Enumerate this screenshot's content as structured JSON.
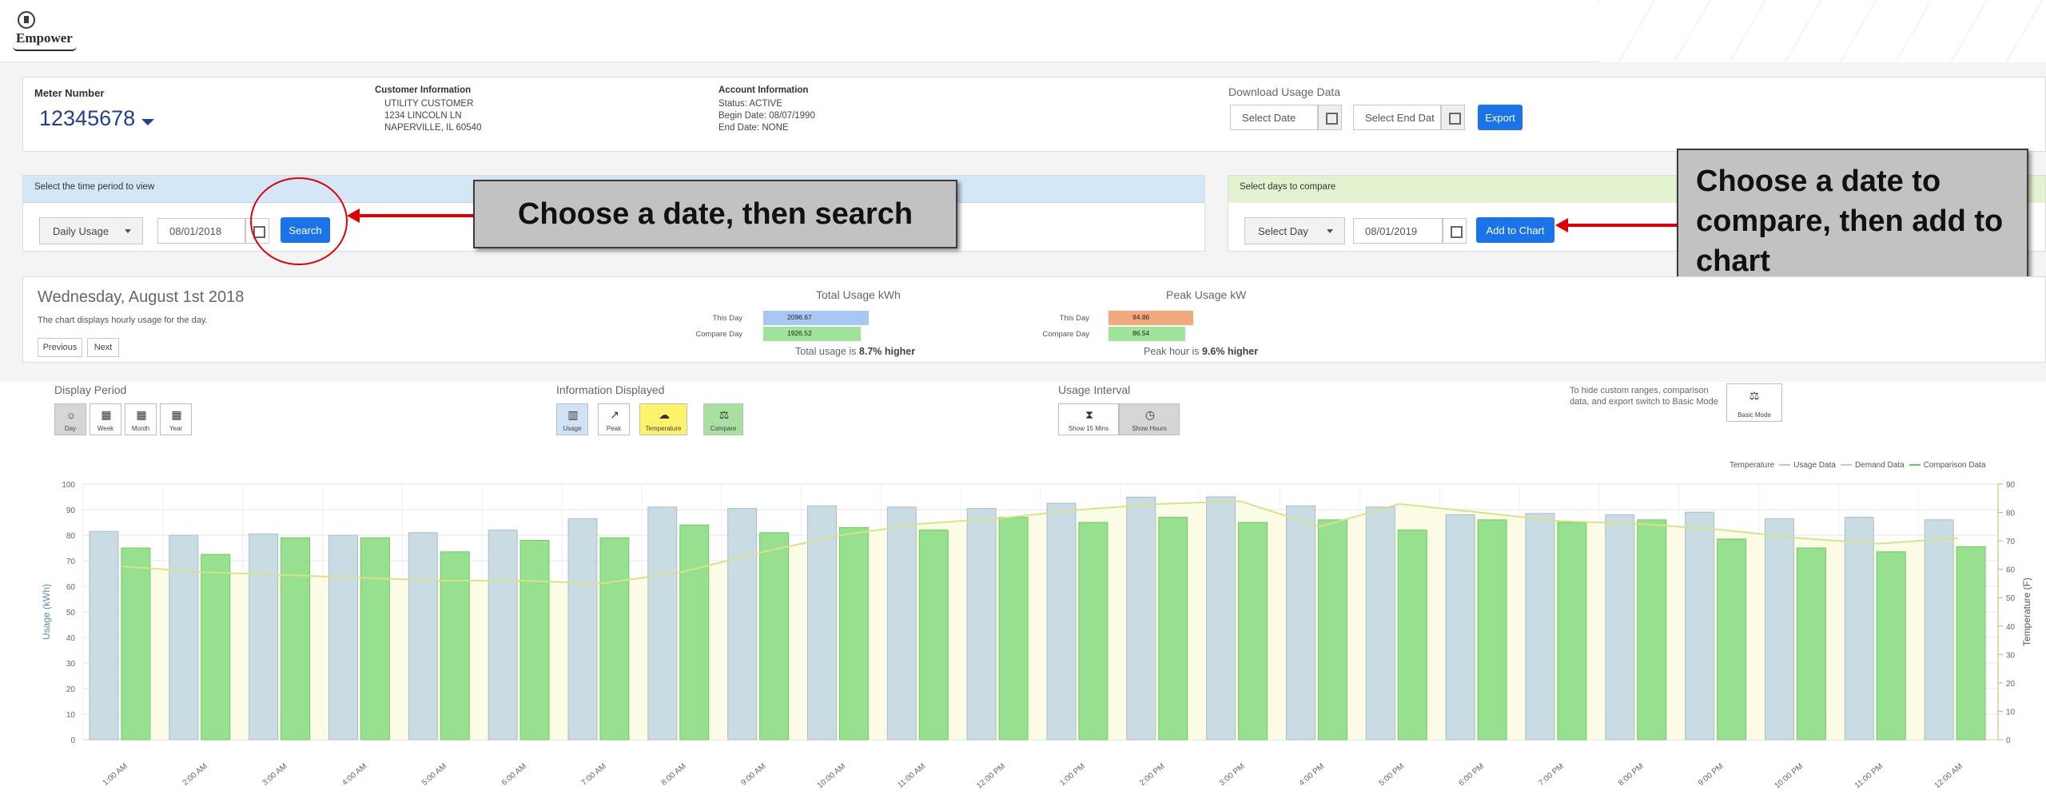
{
  "brand": {
    "logo_text": "Empower"
  },
  "meter": {
    "label": "Meter Number",
    "number": "12345678"
  },
  "customer": {
    "label": "Customer Information",
    "lines": [
      "UTILITY CUSTOMER",
      "1234 LINCOLN LN",
      "NAPERVILLE, IL 60540"
    ]
  },
  "account": {
    "label": "Account Information",
    "lines": [
      "Status: ACTIVE",
      "Begin Date: 08/07/1990",
      "End Date: NONE"
    ]
  },
  "download": {
    "label": "Download Usage Data",
    "start_placeholder": "Select Date",
    "end_placeholder": "Select End Dat",
    "export_label": "Export"
  },
  "period_panel": {
    "header": "Select the time period to view",
    "select_value": "Daily Usage",
    "date_value": "08/01/2018",
    "search_label": "Search"
  },
  "compare_panel": {
    "header": "Select days to compare",
    "select_value": "Select Day",
    "date_value": "08/01/2019",
    "add_label": "Add to Chart"
  },
  "callouts": {
    "search": "Choose a date, then search",
    "compare": "Choose a date to compare, then add to chart"
  },
  "summary": {
    "date_title": "Wednesday, August 1st 2018",
    "subtitle": "The chart displays hourly usage for the day.",
    "prev_label": "Previous",
    "next_label": "Next",
    "total_title": "Total Usage kWh",
    "this_day_label": "This Day",
    "compare_day_label": "Compare Day",
    "total_this_day": "2096.67",
    "total_compare_day": "1926.52",
    "total_note_prefix": "Total usage is ",
    "total_note_value": "8.7% higher",
    "peak_title": "Peak Usage kW",
    "peak_this_day": "94.86",
    "peak_compare_day": "86.54",
    "peak_note_prefix": "Peak hour is ",
    "peak_note_value": "9.6% higher"
  },
  "controls": {
    "display_period_title": "Display Period",
    "display_period": [
      "Day",
      "Week",
      "Month",
      "Year"
    ],
    "info_title": "Information Displayed",
    "info": [
      "Usage",
      "Peak",
      "Temperature",
      "Compare"
    ],
    "interval_title": "Usage Interval",
    "interval": [
      "Show 15 Mins",
      "Show Hours"
    ],
    "hint": "To hide custom ranges, comparison data, and export switch to Basic Mode",
    "basic_mode_label": "Basic Mode"
  },
  "colors": {
    "usage": "#c9dbe3",
    "compare": "#96e08f",
    "temperature": "#d8e28a",
    "accent": "#1a73e8",
    "annotation": "#e00000"
  },
  "chart_data": {
    "type": "bar",
    "categories": [
      "1:00 AM",
      "2:00 AM",
      "3:00 AM",
      "4:00 AM",
      "5:00 AM",
      "6:00 AM",
      "7:00 AM",
      "8:00 AM",
      "9:00 AM",
      "10:00 AM",
      "11:00 AM",
      "12:00 PM",
      "1:00 PM",
      "2:00 PM",
      "3:00 PM",
      "4:00 PM",
      "5:00 PM",
      "6:00 PM",
      "7:00 PM",
      "8:00 PM",
      "9:00 PM",
      "10:00 PM",
      "11:00 PM",
      "12:00 AM"
    ],
    "series": [
      {
        "name": "Usage Data",
        "values": [
          81.5,
          80,
          80.5,
          80,
          81,
          82,
          86.5,
          91,
          90.5,
          91.5,
          91,
          90.5,
          92.5,
          94.9,
          95,
          91.5,
          91,
          88,
          88.5,
          88,
          89,
          86.5,
          87,
          86
        ]
      },
      {
        "name": "Comparison Data",
        "values": [
          75,
          72.5,
          79,
          79,
          73.5,
          78,
          79,
          84,
          81,
          83,
          82,
          87,
          85,
          87,
          85,
          86,
          82,
          86,
          85,
          86,
          78.5,
          75,
          73.5,
          75.5
        ]
      },
      {
        "name": "Temperature",
        "axis": "right",
        "values": [
          61,
          59,
          58,
          57,
          56,
          56,
          55,
          59,
          66,
          72,
          76,
          78,
          81,
          83,
          84,
          75,
          83,
          80,
          77,
          76,
          74,
          71,
          69,
          71
        ]
      }
    ],
    "legend": [
      "Temperature",
      "Usage Data",
      "Demand Data",
      "Comparison Data"
    ],
    "ylabel": "Usage (kWh)",
    "y2label": "Temperature (F)",
    "ylim": [
      0,
      100
    ],
    "y2lim": [
      0,
      90
    ],
    "yticks": [
      0,
      10,
      20,
      30,
      40,
      50,
      60,
      70,
      80,
      90,
      100
    ],
    "y2ticks": [
      0,
      10,
      20,
      30,
      40,
      50,
      60,
      70,
      80,
      90
    ],
    "grid": true,
    "legend_position": "top-right"
  }
}
